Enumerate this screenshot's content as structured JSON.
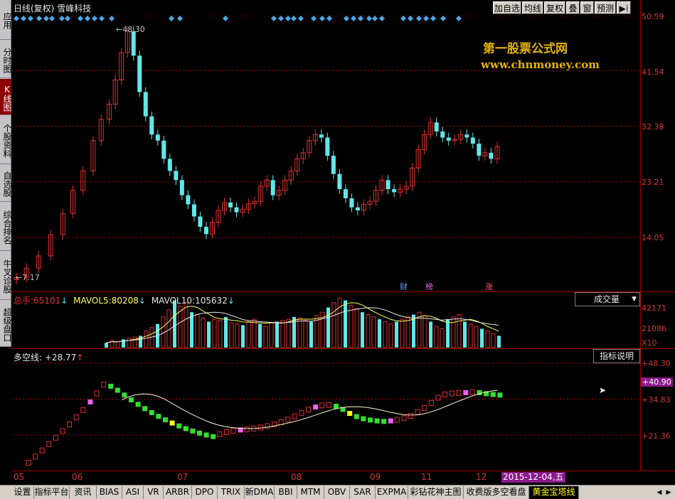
{
  "left_nav": [
    {
      "label": "应用"
    },
    {
      "label": "分时图"
    },
    {
      "label": "K线图",
      "active": true
    },
    {
      "label": "个股资料"
    },
    {
      "label": "自选股"
    },
    {
      "label": "综合排名"
    },
    {
      "label": "牛叉诊股"
    },
    {
      "label": "超级盘口"
    }
  ],
  "header": {
    "period": "日线(复权)",
    "stock_name": "雪峰科技",
    "buttons": [
      "加自选",
      "均线",
      "复权",
      "叠",
      "窗",
      "预测"
    ],
    "menu_icon": "arrow-menu-icon"
  },
  "watermark": {
    "title": "第一股票公式网",
    "url": "www.chnmoney.com"
  },
  "price_axis": [
    "50.59",
    "41.54",
    "32.38",
    "23.21",
    "14.05"
  ],
  "high_marker": "48.30",
  "low_marker": "7.17",
  "event_tags": [
    "财",
    "榜",
    "涨"
  ],
  "volume_panel": {
    "total_label": "总手:",
    "total_value": "65101",
    "mavol5_label": "MAVOL5:",
    "mavol5_value": "80208",
    "mavol10_label": "MAVOL10:",
    "mavol10_value": "105632",
    "selector": "成交量",
    "axis": [
      "42171",
      "21086",
      "X10"
    ]
  },
  "indicator_panel": {
    "name": "多空线:",
    "value": "+28.77",
    "button": "指标说明",
    "axis": [
      "+48.30",
      "+40.90",
      "+34.83",
      "+21.36"
    ]
  },
  "date_axis": [
    "05",
    "06",
    "07",
    "08",
    "09",
    "11",
    "12"
  ],
  "date_highlight": "2015-12-04,五",
  "bottom_tabs": [
    {
      "label": "设置"
    },
    {
      "label": "指标平台"
    },
    {
      "label": "资讯"
    },
    {
      "label": "BIAS"
    },
    {
      "label": "ASI"
    },
    {
      "label": "VR"
    },
    {
      "label": "ARBR"
    },
    {
      "label": "DPO"
    },
    {
      "label": "TRIX"
    },
    {
      "label": "新DMA"
    },
    {
      "label": "BBI"
    },
    {
      "label": "MTM"
    },
    {
      "label": "OBV"
    },
    {
      "label": "SAR"
    },
    {
      "label": "EXPMA"
    },
    {
      "label": "彩钻花神主图"
    },
    {
      "label": "收费版多空看盘"
    },
    {
      "label": "黄金宝塔线",
      "active": true
    }
  ],
  "colors": {
    "up": "#e03030",
    "down": "#60e8e8",
    "axis": "#d03838",
    "grid": "#a00000",
    "accent": "#e6b400",
    "dkx_green": "#33e02f",
    "dkx_magenta": "#f060f0",
    "dkx_yellow": "#ffff00"
  }
}
